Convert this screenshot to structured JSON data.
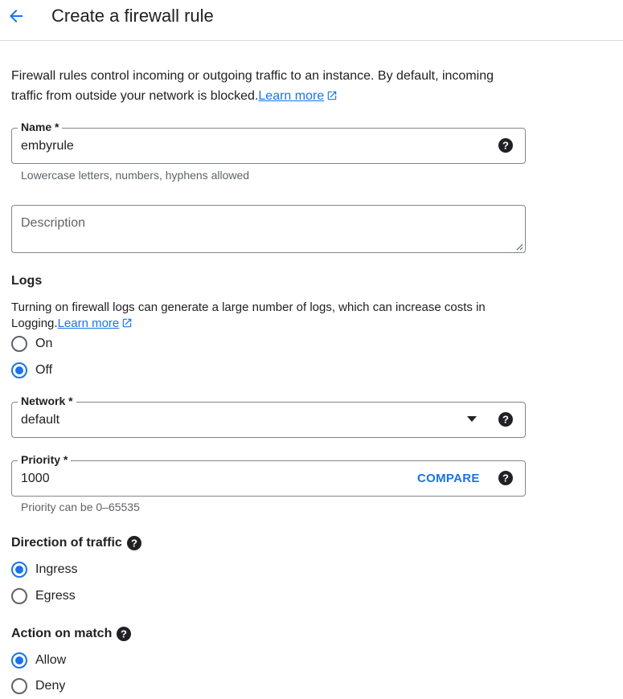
{
  "header": {
    "title": "Create a firewall rule"
  },
  "intro": {
    "text": "Firewall rules control incoming or outgoing traffic to an instance. By default, incoming traffic from outside your network is blocked.",
    "link": "Learn more"
  },
  "name_field": {
    "label": "Name *",
    "value": "embyrule",
    "hint": "Lowercase letters, numbers, hyphens allowed"
  },
  "description_field": {
    "placeholder": "Description"
  },
  "logs": {
    "title": "Logs",
    "description": "Turning on firewall logs can generate a large number of logs, which can increase costs in Logging.",
    "link": "Learn more",
    "options": [
      {
        "label": "On",
        "checked": false
      },
      {
        "label": "Off",
        "checked": true
      }
    ]
  },
  "network_field": {
    "label": "Network *",
    "value": "default"
  },
  "priority_field": {
    "label": "Priority *",
    "value": "1000",
    "compare_label": "COMPARE",
    "hint": "Priority can be 0–65535"
  },
  "direction": {
    "title": "Direction of traffic",
    "options": [
      {
        "label": "Ingress",
        "checked": true
      },
      {
        "label": "Egress",
        "checked": false
      }
    ]
  },
  "action": {
    "title": "Action on match",
    "options": [
      {
        "label": "Allow",
        "checked": true
      },
      {
        "label": "Deny",
        "checked": false
      }
    ]
  },
  "colors": {
    "accent": "#1a73e8",
    "text": "#202124",
    "secondary_text": "#5f6368",
    "border": "#80868b"
  }
}
